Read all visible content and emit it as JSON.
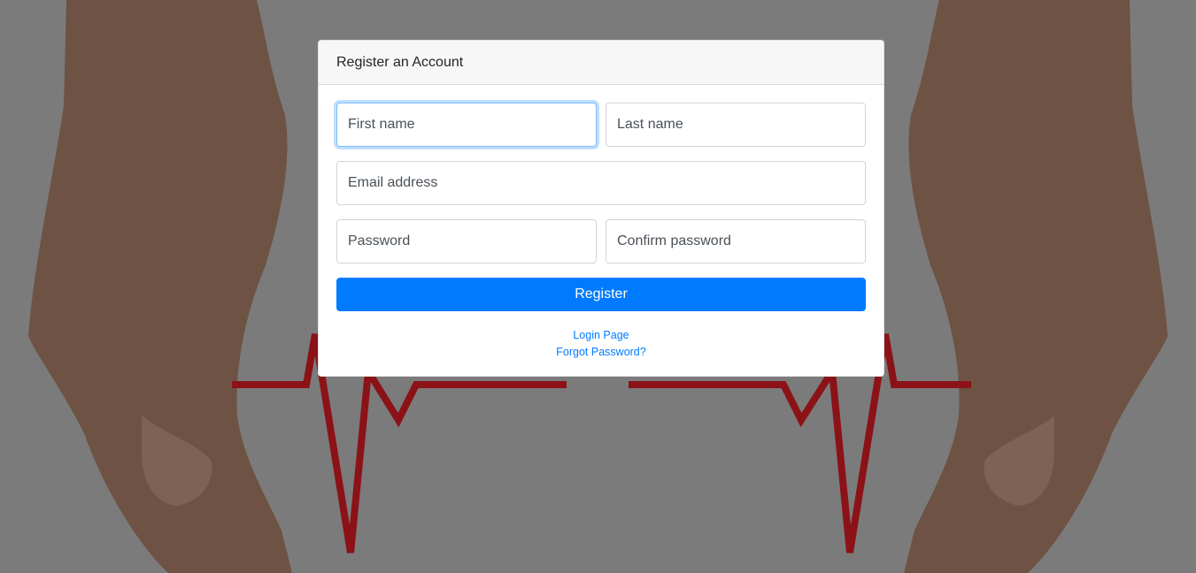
{
  "register_card": {
    "header_title": "Register an Account",
    "first_name_placeholder": "First name",
    "last_name_placeholder": "Last name",
    "email_placeholder": "Email address",
    "password_placeholder": "Password",
    "confirm_password_placeholder": "Confirm password",
    "register_button_label": "Register",
    "login_link_label": "Login Page",
    "forgot_password_link_label": "Forgot Password?"
  },
  "colors": {
    "background_overlay": "#7b7b7b",
    "primary": "#007bff",
    "heartbeat_line": "#8b1217",
    "skin": "#7a5a48"
  }
}
